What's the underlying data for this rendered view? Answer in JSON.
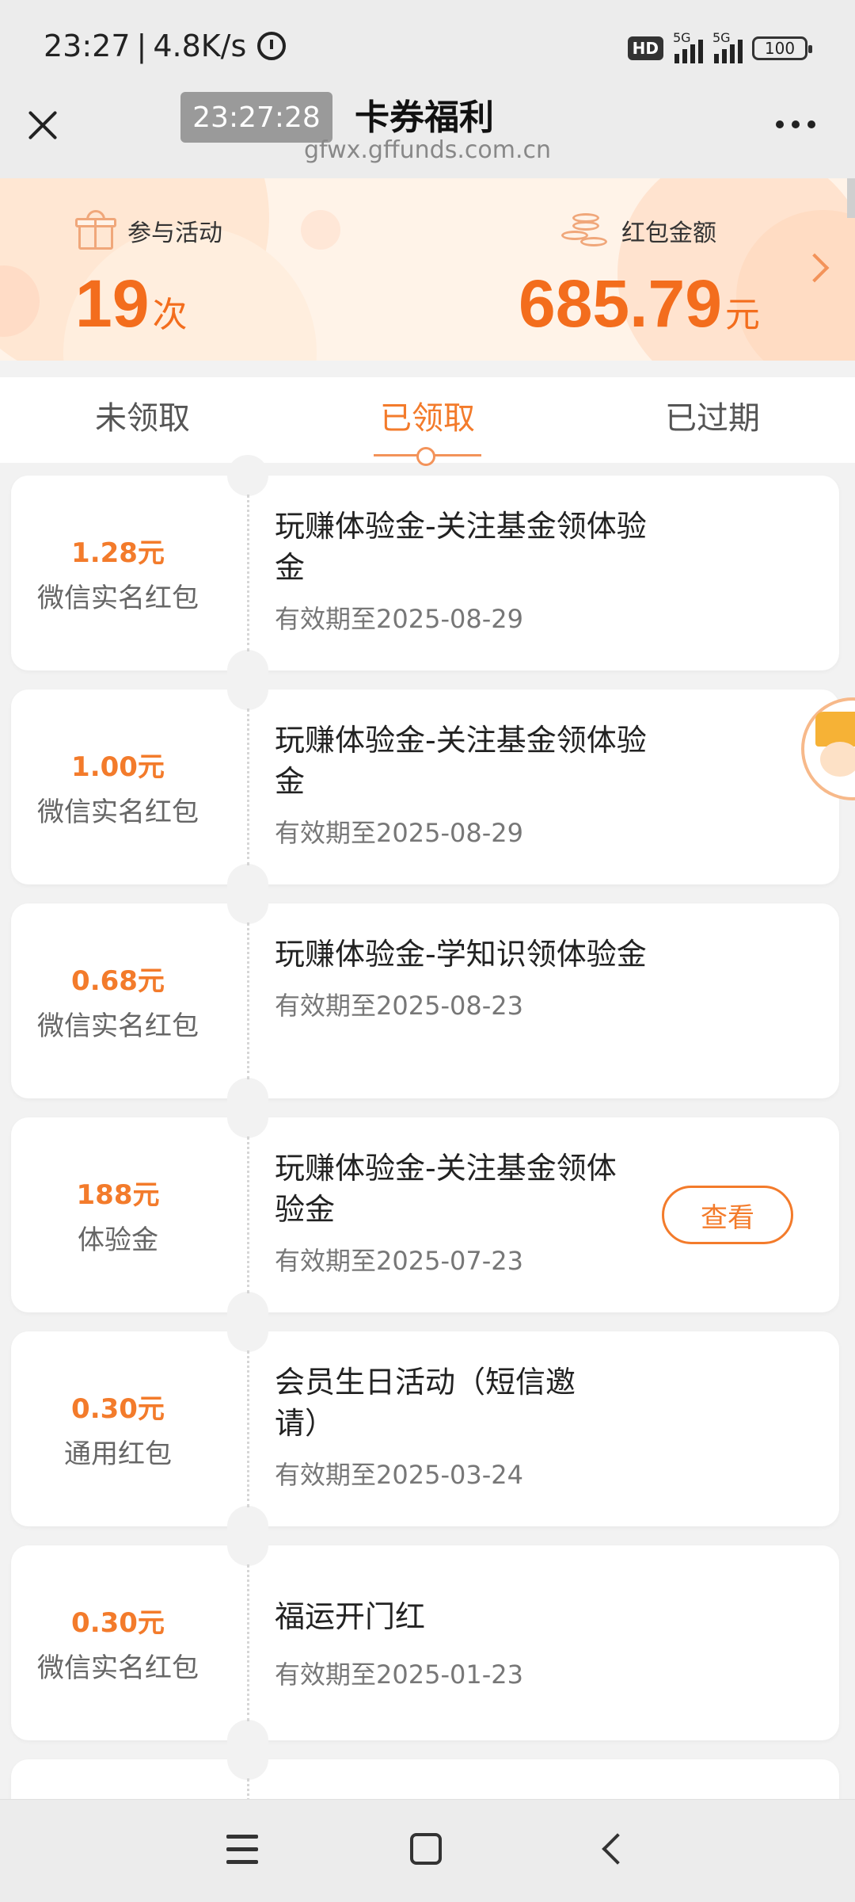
{
  "status_bar": {
    "time": "23:27",
    "network_speed": "4.8K/s",
    "hd_badge": "HD",
    "sim1": "5G",
    "sim2": "5G",
    "battery": "100"
  },
  "nav": {
    "time_chip": "23:27:28",
    "title": "卡券福利",
    "url": "gfwx.gffunds.com.cn"
  },
  "summary": {
    "participation_label": "参与活动",
    "participation_count": "19",
    "participation_unit": "次",
    "redpacket_label": "红包金额",
    "redpacket_amount": "685.79",
    "redpacket_unit": "元"
  },
  "tabs": [
    {
      "label": "未领取",
      "active": false
    },
    {
      "label": "已领取",
      "active": true
    },
    {
      "label": "已过期",
      "active": false
    }
  ],
  "coupons": [
    {
      "amount": "1.28元",
      "type": "微信实名红包",
      "title": "玩赚体验金-关注基金领体验金",
      "expiry": "有效期至2025-08-29"
    },
    {
      "amount": "1.00元",
      "type": "微信实名红包",
      "title": "玩赚体验金-关注基金领体验金",
      "expiry": "有效期至2025-08-29"
    },
    {
      "amount": "0.68元",
      "type": "微信实名红包",
      "title": "玩赚体验金-学知识领体验金",
      "expiry": "有效期至2025-08-23"
    },
    {
      "amount": "188元",
      "type": "体验金",
      "title": "玩赚体验金-关注基金领体验金",
      "expiry": "有效期至2025-07-23",
      "button": "查看"
    },
    {
      "amount": "0.30元",
      "type": "通用红包",
      "title": "会员生日活动（短信邀请）",
      "expiry": "有效期至2025-03-24"
    },
    {
      "amount": "0.30元",
      "type": "微信实名红包",
      "title": "福运开门红",
      "expiry": "有效期至2025-01-23"
    }
  ],
  "colors": {
    "accent": "#f37b2b",
    "background": "#f2f2f2",
    "header_bg": "#fff3e8"
  }
}
